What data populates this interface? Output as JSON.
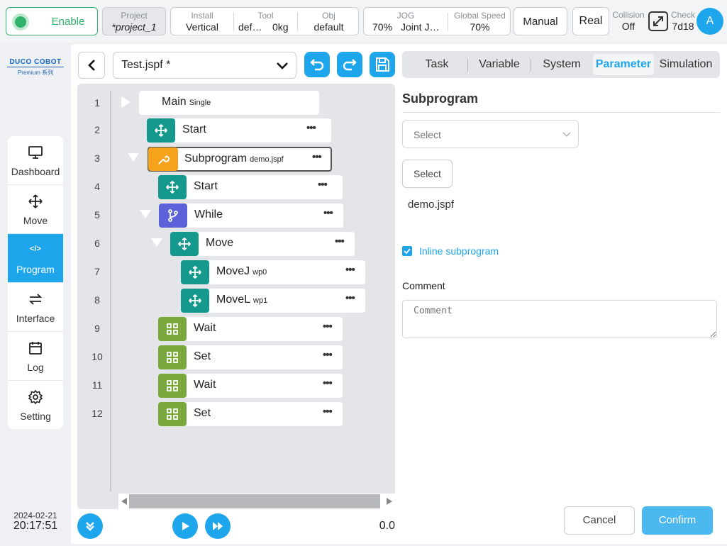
{
  "topbar": {
    "enable_label": "Enable",
    "project": {
      "caption": "Project",
      "value": "*project_1"
    },
    "install": {
      "caption": "Install",
      "value": "Vertical"
    },
    "tool": {
      "caption": "Tool",
      "value1": "def…",
      "value2": "0kg"
    },
    "obj": {
      "caption": "Obj",
      "value": "default"
    },
    "jog": {
      "caption": "JOG",
      "value1": "70%",
      "value2": "Joint J…"
    },
    "global_speed": {
      "caption": "Global Speed",
      "value": "70%"
    },
    "mode_label": "Manual",
    "real_label": "Real",
    "collision": {
      "caption": "Collision",
      "value": "Off"
    },
    "check": {
      "caption": "Check",
      "value": "7d18"
    },
    "avatar_letter": "A"
  },
  "brand": {
    "name": "DUCO COBOT",
    "sub": "Premium 系列"
  },
  "sidebar": {
    "items": [
      {
        "label": "Dashboard"
      },
      {
        "label": "Move"
      },
      {
        "label": "Program",
        "icon_text": "</>"
      },
      {
        "label": "Interface"
      },
      {
        "label": "Log"
      },
      {
        "label": "Setting"
      }
    ],
    "date": "2024-02-21",
    "time": "20:17:51"
  },
  "editor": {
    "file_name": "Test.jspf *",
    "speed_value": "0.0"
  },
  "tree": {
    "line_numbers": [
      "1",
      "2",
      "3",
      "4",
      "5",
      "6",
      "7",
      "8",
      "9",
      "10",
      "11",
      "12"
    ],
    "nodes": [
      {
        "label": "Main",
        "sub": "Single",
        "icon": "play-triangle"
      },
      {
        "label": "Start",
        "sub": "",
        "icon": "move-icon"
      },
      {
        "label": "Subprogram",
        "sub": "demo.jspf",
        "icon": "wrench-icon"
      },
      {
        "label": "Start",
        "sub": "",
        "icon": "move-icon"
      },
      {
        "label": "While",
        "sub": "",
        "icon": "branch-icon"
      },
      {
        "label": "Move",
        "sub": "",
        "icon": "move-icon"
      },
      {
        "label": "MoveJ",
        "sub": "wp0",
        "icon": "move-icon"
      },
      {
        "label": "MoveL",
        "sub": "wp1",
        "icon": "move-icon"
      },
      {
        "label": "Wait",
        "sub": "",
        "icon": "grid-icon"
      },
      {
        "label": "Set",
        "sub": "",
        "icon": "grid-icon"
      },
      {
        "label": "Wait",
        "sub": "",
        "icon": "grid-icon"
      },
      {
        "label": "Set",
        "sub": "",
        "icon": "grid-icon"
      }
    ],
    "more_glyph": "•••"
  },
  "tabs": [
    {
      "label": "Task"
    },
    {
      "label": "Variable"
    },
    {
      "label": "System"
    },
    {
      "label": "Parameter"
    },
    {
      "label": "Simulation"
    }
  ],
  "panel": {
    "title": "Subprogram",
    "select_placeholder": "Select",
    "select_button": "Select",
    "file": "demo.jspf",
    "inline_label": "Inline subprogram",
    "inline_checked": true,
    "comment_label": "Comment",
    "comment_placeholder": "Comment",
    "cancel_label": "Cancel",
    "confirm_label": "Confirm"
  },
  "colors": {
    "accent": "#1ea6ec",
    "teal": "#16998d",
    "orange": "#f7a21b",
    "purple": "#5b62d9",
    "green": "#7aa83a",
    "enable_green": "#2fb36a"
  }
}
